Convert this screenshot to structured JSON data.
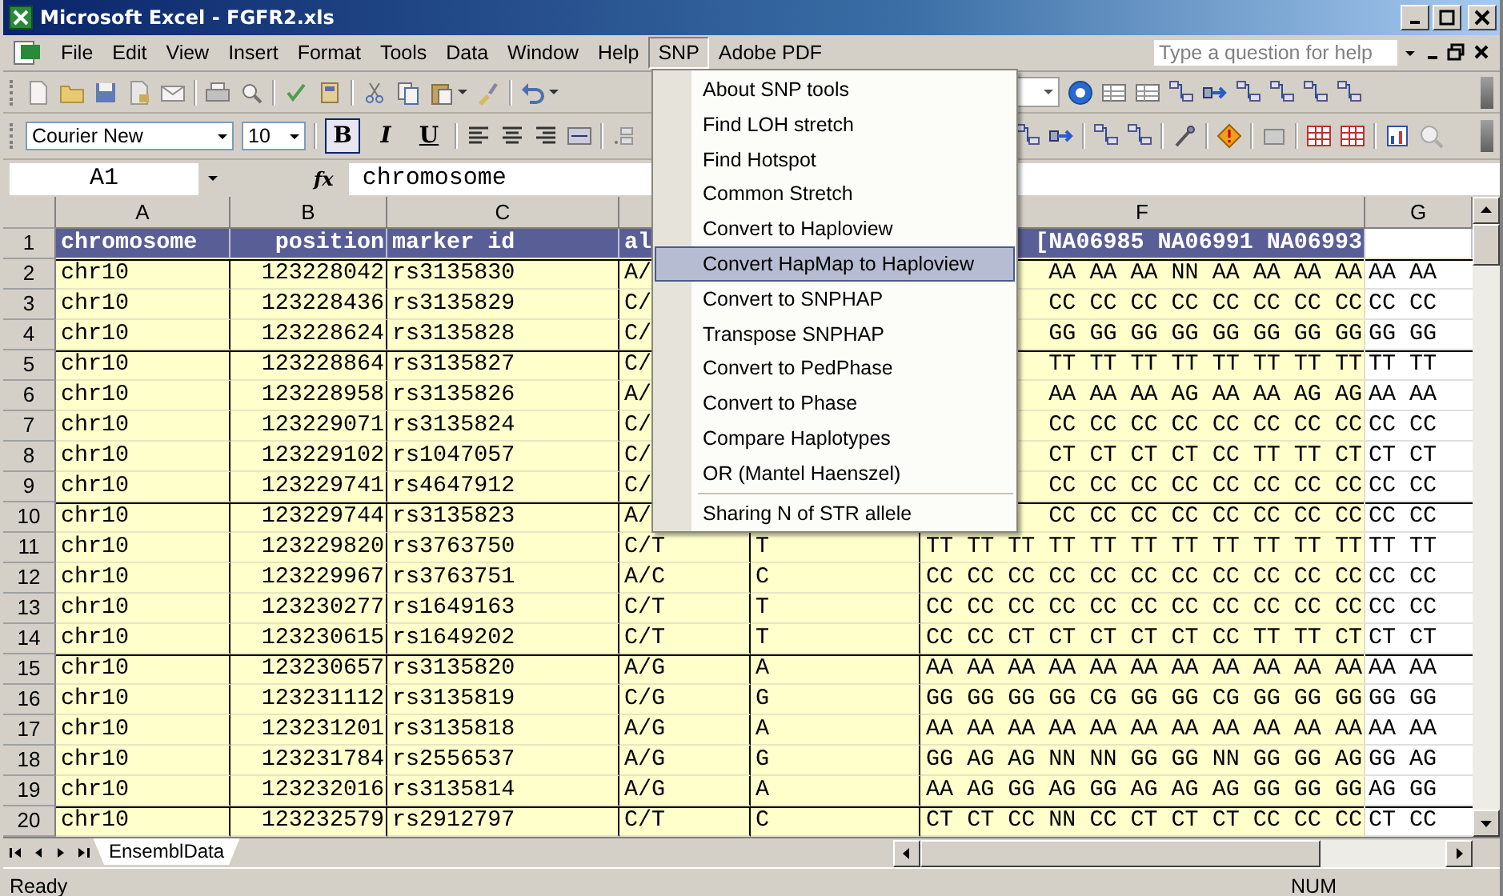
{
  "window": {
    "title": "Microsoft Excel - FGFR2.xls"
  },
  "menu_bar": [
    {
      "label": "File",
      "selected": false
    },
    {
      "label": "Edit",
      "selected": false
    },
    {
      "label": "View",
      "selected": false
    },
    {
      "label": "Insert",
      "selected": false
    },
    {
      "label": "Format",
      "selected": false
    },
    {
      "label": "Tools",
      "selected": false
    },
    {
      "label": "Data",
      "selected": false
    },
    {
      "label": "Window",
      "selected": false
    },
    {
      "label": "Help",
      "selected": false
    },
    {
      "label": "SNP",
      "selected": true
    },
    {
      "label": "Adobe PDF",
      "selected": false
    }
  ],
  "help_search": {
    "placeholder": "Type a question for help"
  },
  "formatting": {
    "font": "Courier New",
    "size": "10",
    "buttons": [
      {
        "label": "B",
        "pressed": true
      },
      {
        "label": "I",
        "pressed": false
      },
      {
        "label": "U",
        "pressed": false
      }
    ]
  },
  "formula_bar": {
    "name_box": "A1",
    "fx": "fx",
    "value": "chromosome"
  },
  "column_headers": {
    "A": "A",
    "B": "B",
    "C": "C",
    "F": "F",
    "G": "G"
  },
  "rows": [
    {
      "number": "1",
      "kind": "header",
      "divider_above": false,
      "cells": {
        "A": "chromosome",
        "B": "position",
        "C": "marker id",
        "D": "al",
        "F": "[NA06985 NA06991 NA06993"
      }
    },
    {
      "number": "2",
      "kind": "data",
      "divider_above": true,
      "cells": {
        "A": "chr10",
        "B": "123228042",
        "C": "rs3135830",
        "D": "A/",
        "F": "AA AA AA NN AA AA AA AA",
        "G": "AA AA"
      }
    },
    {
      "number": "3",
      "kind": "data",
      "divider_above": false,
      "cells": {
        "A": "chr10",
        "B": "123228436",
        "C": "rs3135829",
        "D": "C/",
        "F": "CC CC CC CC CC CC CC CC",
        "G": "CC CC"
      }
    },
    {
      "number": "4",
      "kind": "data",
      "divider_above": false,
      "cells": {
        "A": "chr10",
        "B": "123228624",
        "C": "rs3135828",
        "D": "C/",
        "F": "GG GG GG GG GG GG GG GG",
        "G": "GG GG"
      }
    },
    {
      "number": "5",
      "kind": "data",
      "divider_above": true,
      "cells": {
        "A": "chr10",
        "B": "123228864",
        "C": "rs3135827",
        "D": "C/",
        "F": "TT TT TT TT TT TT TT TT",
        "G": "TT TT"
      }
    },
    {
      "number": "6",
      "kind": "data",
      "divider_above": false,
      "cells": {
        "A": "chr10",
        "B": "123228958",
        "C": "rs3135826",
        "D": "A/",
        "F": "AA AA AA AG AA AA AG AG",
        "G": "AA AA"
      }
    },
    {
      "number": "7",
      "kind": "data",
      "divider_above": false,
      "cells": {
        "A": "chr10",
        "B": "123229071",
        "C": "rs3135824",
        "D": "C/",
        "F": "CC CC CC CC CC CC CC CC",
        "G": "CC CC"
      }
    },
    {
      "number": "8",
      "kind": "data",
      "divider_above": false,
      "cells": {
        "A": "chr10",
        "B": "123229102",
        "C": "rs1047057",
        "D": "C/",
        "F": "CT CT CT CT CC TT TT CT",
        "G": "CT CT"
      }
    },
    {
      "number": "9",
      "kind": "data",
      "divider_above": false,
      "cells": {
        "A": "chr10",
        "B": "123229741",
        "C": "rs4647912",
        "D": "C/",
        "F": "CC CC CC CC CC CC CC CC",
        "G": "CC CC"
      }
    },
    {
      "number": "10",
      "kind": "data",
      "divider_above": true,
      "cells": {
        "A": "chr10",
        "B": "123229744",
        "C": "rs3135823",
        "D": "A/",
        "F": "CC CC CC CC CC CC CC CC",
        "G": "CC CC"
      }
    },
    {
      "number": "11",
      "kind": "data",
      "divider_above": false,
      "cells": {
        "A": "chr10",
        "B": "123229820",
        "C": "rs3763750",
        "D": "C/T",
        "E": "T",
        "F": "TT TT TT TT TT TT TT TT TT TT TT",
        "G": "TT TT"
      }
    },
    {
      "number": "12",
      "kind": "data",
      "divider_above": false,
      "cells": {
        "A": "chr10",
        "B": "123229967",
        "C": "rs3763751",
        "D": "A/C",
        "E": "C",
        "F": "CC CC CC CC CC CC CC CC CC CC CC",
        "G": "CC CC"
      }
    },
    {
      "number": "13",
      "kind": "data",
      "divider_above": false,
      "cells": {
        "A": "chr10",
        "B": "123230277",
        "C": "rs1649163",
        "D": "C/T",
        "E": "T",
        "F": "CC CC CC CC CC CC CC CC CC CC CC",
        "G": "CC CC"
      }
    },
    {
      "number": "14",
      "kind": "data",
      "divider_above": false,
      "cells": {
        "A": "chr10",
        "B": "123230615",
        "C": "rs1649202",
        "D": "C/T",
        "E": "T",
        "F": "CC CC CT CT CT CT CT CC TT TT CT",
        "G": "CT CT"
      }
    },
    {
      "number": "15",
      "kind": "data",
      "divider_above": true,
      "cells": {
        "A": "chr10",
        "B": "123230657",
        "C": "rs3135820",
        "D": "A/G",
        "E": "A",
        "F": "AA AA AA AA AA AA AA AA AA AA AA",
        "G": "AA AA"
      }
    },
    {
      "number": "16",
      "kind": "data",
      "divider_above": false,
      "cells": {
        "A": "chr10",
        "B": "123231112",
        "C": "rs3135819",
        "D": "C/G",
        "E": "G",
        "F": "GG GG GG GG CG GG GG CG GG GG GG",
        "G": "GG GG"
      }
    },
    {
      "number": "17",
      "kind": "data",
      "divider_above": false,
      "cells": {
        "A": "chr10",
        "B": "123231201",
        "C": "rs3135818",
        "D": "A/G",
        "E": "A",
        "F": "AA AA AA AA AA AA AA AA AA AA AA",
        "G": "AA AA"
      }
    },
    {
      "number": "18",
      "kind": "data",
      "divider_above": false,
      "cells": {
        "A": "chr10",
        "B": "123231784",
        "C": "rs2556537",
        "D": "A/G",
        "E": "G",
        "F": "GG AG AG NN NN GG GG NN GG GG AG",
        "G": "GG AG"
      }
    },
    {
      "number": "19",
      "kind": "data",
      "divider_above": false,
      "cells": {
        "A": "chr10",
        "B": "123232016",
        "C": "rs3135814",
        "D": "A/G",
        "E": "A",
        "F": "AA AG GG AG GG AG AG AG GG GG GG",
        "G": "AG GG"
      }
    },
    {
      "number": "20",
      "kind": "data",
      "divider_above": true,
      "cells": {
        "A": "chr10",
        "B": "123232579",
        "C": "rs2912797",
        "D": "C/T",
        "E": "C",
        "F": "CT CT CC NN CC CT CT CT CC CC CC",
        "G": "CT CC"
      }
    }
  ],
  "snp_menu": [
    {
      "label": "About SNP tools",
      "selected": false,
      "separator_before": false
    },
    {
      "label": "Find LOH stretch",
      "selected": false,
      "separator_before": false
    },
    {
      "label": "Find Hotspot",
      "selected": false,
      "separator_before": false
    },
    {
      "label": "Common Stretch",
      "selected": false,
      "separator_before": false
    },
    {
      "label": "Convert to Haploview",
      "selected": false,
      "separator_before": false
    },
    {
      "label": "Convert HapMap to Haploview",
      "selected": true,
      "separator_before": false
    },
    {
      "label": "Convert to SNPHAP",
      "selected": false,
      "separator_before": false
    },
    {
      "label": "Transpose SNPHAP",
      "selected": false,
      "separator_before": false
    },
    {
      "label": "Convert to PedPhase",
      "selected": false,
      "separator_before": false
    },
    {
      "label": "Convert to Phase",
      "selected": false,
      "separator_before": false
    },
    {
      "label": "Compare Haplotypes",
      "selected": false,
      "separator_before": false
    },
    {
      "label": "OR (Mantel Haenszel)",
      "selected": false,
      "separator_before": false
    },
    {
      "label": "Sharing N of STR allele",
      "selected": false,
      "separator_before": true
    }
  ],
  "sheet_tabs": [
    {
      "label": "EnsemblData",
      "selected": true
    }
  ],
  "status_bar": {
    "text": "Ready",
    "indicator": "NUM"
  }
}
